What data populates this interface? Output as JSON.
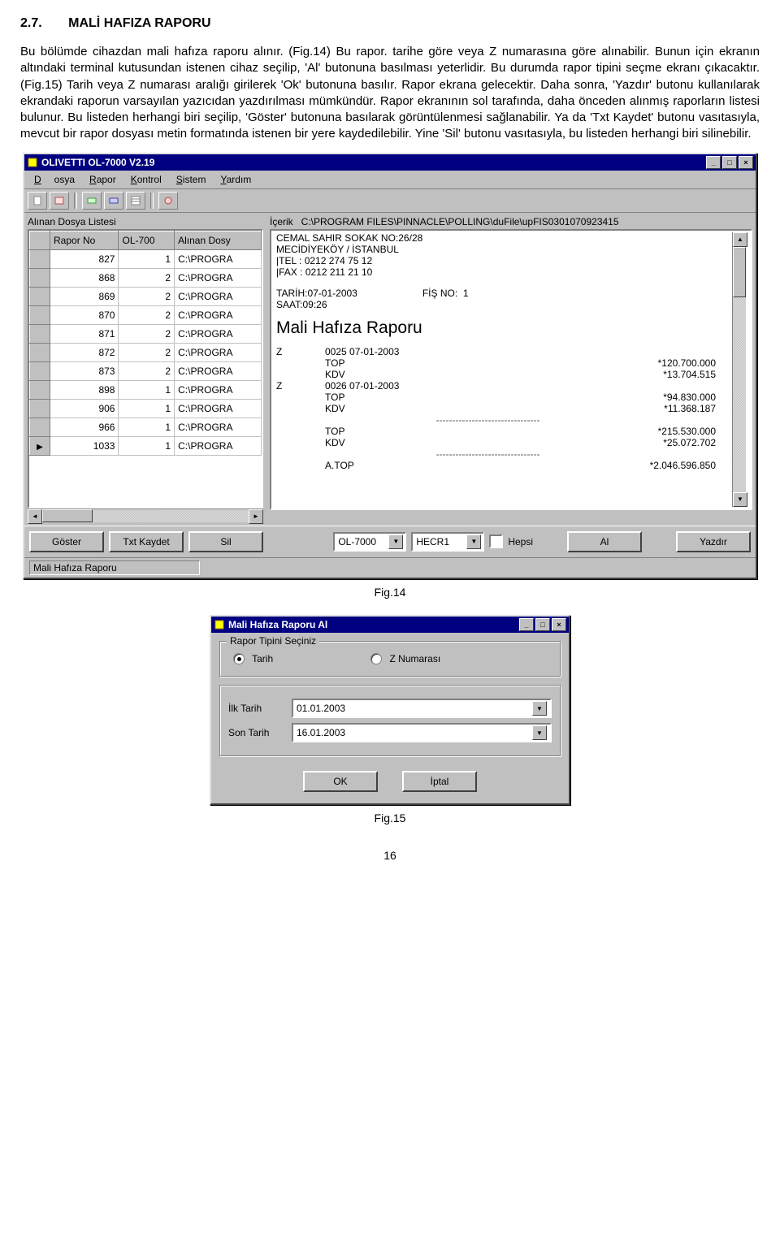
{
  "heading": {
    "num": "2.7.",
    "title": "MALİ HAFIZA RAPORU"
  },
  "paragraph": "Bu bölümde cihazdan mali hafıza raporu alınır. (Fig.14) Bu rapor. tarihe göre veya Z numarasına göre alınabilir. Bunun için ekranın altındaki terminal kutusundan istenen cihaz seçilip, 'Al' butonuna basılması yeterlidir. Bu durumda rapor tipini seçme ekranı çıkacaktır. (Fig.15) Tarih veya Z numarası aralığı girilerek 'Ok' butonuna basılır. Rapor ekrana gelecektir. Daha sonra,  'Yazdır' butonu kullanılarak ekrandaki raporun varsayılan yazıcıdan yazdırılması mümkündür. Rapor ekranının sol tarafında, daha önceden alınmış raporların listesi bulunur. Bu listeden herhangi biri seçilip, 'Göster' butonuna basılarak görüntülenmesi sağlanabilir. Ya da 'Txt Kaydet' butonu vasıtasıyla, mevcut bir rapor dosyası metin formatında istenen bir yere kaydedilebilir. Yine 'Sil' butonu vasıtasıyla, bu listeden herhangi biri silinebilir.",
  "fig14": "Fig.14",
  "fig15": "Fig.15",
  "pagenum": "16",
  "app": {
    "title": "OLIVETTI OL-7000 V2.19",
    "menu": {
      "dosya": "Dosya",
      "rapor": "Rapor",
      "kontrol": "Kontrol",
      "sistem": "Sistem",
      "yardim": "Yardım"
    },
    "left_label": "Alınan Dosya Listesi",
    "right_label": "İçerik",
    "right_path": "C:\\PROGRAM FILES\\PINNACLE\\POLLING\\duFile\\upFIS0301070923415",
    "grid": {
      "headers": {
        "rapor": "Rapor No",
        "ol": "OL-700",
        "alinan": "Alınan Dosy"
      },
      "rows": [
        {
          "no": "827",
          "ol": "1",
          "dosya": "C:\\PROGRA"
        },
        {
          "no": "868",
          "ol": "2",
          "dosya": "C:\\PROGRA"
        },
        {
          "no": "869",
          "ol": "2",
          "dosya": "C:\\PROGRA"
        },
        {
          "no": "870",
          "ol": "2",
          "dosya": "C:\\PROGRA"
        },
        {
          "no": "871",
          "ol": "2",
          "dosya": "C:\\PROGRA"
        },
        {
          "no": "872",
          "ol": "2",
          "dosya": "C:\\PROGRA"
        },
        {
          "no": "873",
          "ol": "2",
          "dosya": "C:\\PROGRA"
        },
        {
          "no": "898",
          "ol": "1",
          "dosya": "C:\\PROGRA"
        },
        {
          "no": "906",
          "ol": "1",
          "dosya": "C:\\PROGRA"
        },
        {
          "no": "966",
          "ol": "1",
          "dosya": "C:\\PROGRA"
        },
        {
          "no": "1033",
          "ol": "1",
          "dosya": "C:\\PROGRA"
        }
      ]
    },
    "content": {
      "addr1": "CEMAL SAHIR SOKAK  NO:26/28",
      "addr2": "MECİDİYEKÖY / İSTANBUL",
      "tel_lbl": "|TEL :",
      "tel": "0212 274 75 12",
      "fax_lbl": "|FAX :",
      "fax": "0212 211 21 10",
      "tarih_lbl": "TARİH:",
      "tarih": "07-01-2003",
      "fisno_lbl": "FİŞ NO:",
      "fisno": "1",
      "saat_lbl": "SAAT:",
      "saat": "09:26",
      "report_title": "Mali Hafıza Raporu",
      "lines": [
        {
          "c1": "Z",
          "c2": "0025",
          "c3": "07-01-2003",
          "cr": ""
        },
        {
          "c1": "",
          "c2": "TOP",
          "c3": "",
          "cr": "*120.700.000"
        },
        {
          "c1": "",
          "c2": "KDV",
          "c3": "",
          "cr": "*13.704.515"
        },
        {
          "c1": "Z",
          "c2": "0026",
          "c3": "07-01-2003",
          "cr": ""
        },
        {
          "c1": "",
          "c2": "TOP",
          "c3": "",
          "cr": "*94.830.000"
        },
        {
          "c1": "",
          "c2": "KDV",
          "c3": "",
          "cr": "*11.368.187"
        }
      ],
      "dash": "--------------------------------",
      "tot_top_lbl": "TOP",
      "tot_top": "*215.530.000",
      "tot_kdv_lbl": "KDV",
      "tot_kdv": "*25.072.702",
      "atop_lbl": "A.TOP",
      "atop": "*2.046.596.850"
    },
    "buttons": {
      "goster": "Göster",
      "txtkaydet": "Txt Kaydet",
      "sil": "Sil",
      "combo1": "OL-7000",
      "combo2": "HECR1",
      "hepsi": "Hepsi",
      "al": "Al",
      "yazdir": "Yazdır"
    },
    "status": "Mali Hafıza Raporu"
  },
  "dlg": {
    "title": "Mali Hafıza Raporu Al",
    "group": "Rapor Tipini Seçiniz",
    "radio_tarih": "Tarih",
    "radio_z": "Z Numarası",
    "ilk_label": "İlk Tarih",
    "ilk_val": "01.01.2003",
    "son_label": "Son Tarih",
    "son_val": "16.01.2003",
    "ok": "OK",
    "iptal": "İptal"
  }
}
